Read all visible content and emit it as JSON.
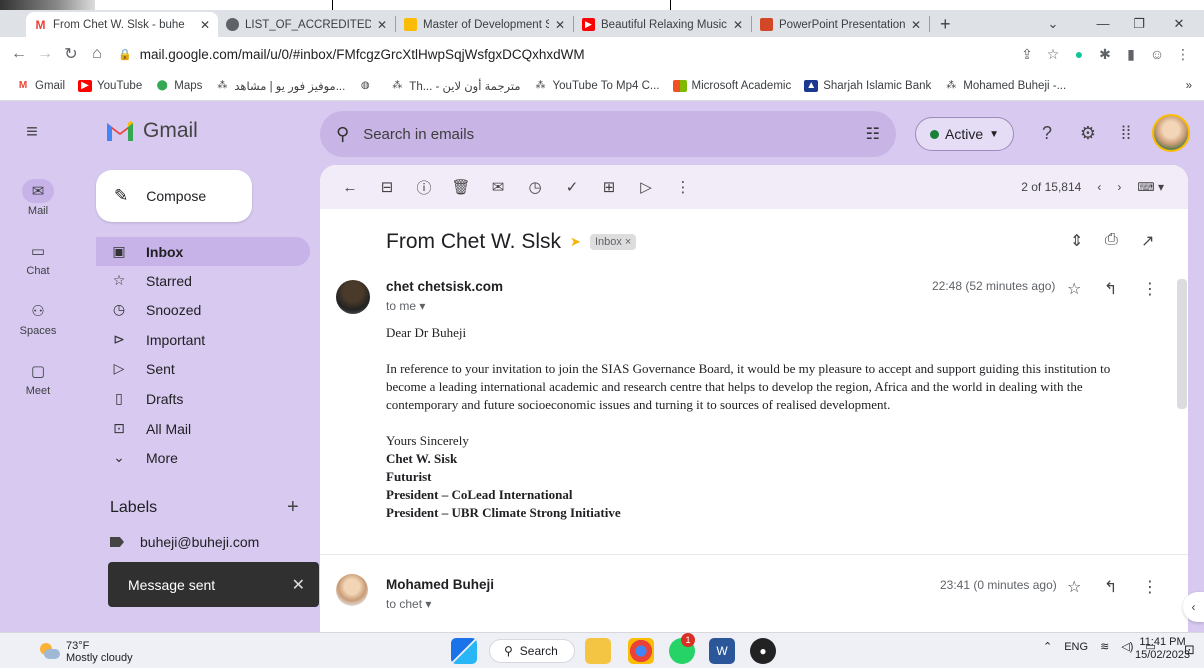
{
  "browser": {
    "tabs": [
      {
        "title": "From Chet W. Slsk - buhe",
        "icon": "gmail-icon",
        "close": "✕"
      },
      {
        "title": "LIST_OF_ACCREDITED_AC",
        "icon": "globe-icon",
        "close": "✕"
      },
      {
        "title": "Master of Development S",
        "icon": "miro-icon",
        "close": "✕"
      },
      {
        "title": "Beautiful Relaxing Music",
        "icon": "youtube-icon",
        "close": "✕"
      },
      {
        "title": "PowerPoint Presentation",
        "icon": "powerpoint-icon",
        "close": "✕"
      }
    ],
    "new_tab": "+",
    "url": "mail.google.com/mail/u/0/#inbox/FMfcgzGrcXtlHwpSqjWsfgxDCQxhxdWM",
    "bookmarks": [
      {
        "label": "Gmail",
        "icon": "gmail-icon"
      },
      {
        "label": "YouTube",
        "icon": "youtube-icon"
      },
      {
        "label": "Maps",
        "icon": "maps-icon"
      },
      {
        "label": "موفيز فور يو | مشاهد...",
        "icon": "bookmark-icon"
      },
      {
        "label": "",
        "icon": "globe-icon"
      },
      {
        "label": "Th... - مترجمة أون لاين",
        "icon": "bookmark-icon"
      },
      {
        "label": "YouTube To Mp4 C...",
        "icon": "bookmark-icon"
      },
      {
        "label": "Microsoft Academic",
        "icon": "microsoft-icon"
      },
      {
        "label": "Sharjah Islamic Bank",
        "icon": "bank-icon"
      },
      {
        "label": "Mohamed Buheji -...",
        "icon": "bookmark-icon"
      }
    ],
    "bookmarks_more": "»"
  },
  "gmail": {
    "logo": "Gmail",
    "search_placeholder": "Search in emails",
    "status": "Active",
    "rail": [
      {
        "label": "Mail",
        "icon": "mail-icon"
      },
      {
        "label": "Chat",
        "icon": "chat-icon"
      },
      {
        "label": "Spaces",
        "icon": "spaces-icon"
      },
      {
        "label": "Meet",
        "icon": "meet-icon"
      }
    ],
    "compose": "Compose",
    "nav": [
      {
        "label": "Inbox",
        "icon": "inbox-icon"
      },
      {
        "label": "Starred",
        "icon": "star-icon"
      },
      {
        "label": "Snoozed",
        "icon": "clock-icon"
      },
      {
        "label": "Important",
        "icon": "important-icon"
      },
      {
        "label": "Sent",
        "icon": "send-icon"
      },
      {
        "label": "Drafts",
        "icon": "draft-icon"
      },
      {
        "label": "All Mail",
        "icon": "all-mail-icon"
      },
      {
        "label": "More",
        "icon": "chevron-down-icon"
      }
    ],
    "labels_title": "Labels",
    "labels_add": "+",
    "labels": [
      "buheji@buheji.com"
    ],
    "toast": {
      "text": "Message sent",
      "close": "✕"
    },
    "pager": {
      "text": "2 of 15,814"
    },
    "thread": {
      "subject": "From Chet W. Slsk",
      "chip": "Inbox ×",
      "messages": [
        {
          "sender": "chet chetsisk.com",
          "to": "to me ▾",
          "time": "22:48 (52 minutes ago)",
          "greeting": "Dear Dr Buheji",
          "paragraph": "In reference to your invitation to join the SIAS Governance Board, it would be my pleasure to accept and support guiding this institution to become a leading international academic and research centre that helps to develop the region, Africa and the world in dealing with the contemporary and future socioeconomic issues and turning it to sources of realised development.",
          "closing": "Yours Sincerely",
          "signature": [
            "Chet W. Sisk",
            "Futurist",
            "President – CoLead International",
            "President – UBR Climate Strong Initiative"
          ]
        },
        {
          "sender": "Mohamed Buheji",
          "to": "to chet ▾",
          "time": "23:41 (0 minutes ago)"
        }
      ]
    }
  },
  "taskbar": {
    "weather_temp": "73°F",
    "weather_desc": "Mostly cloudy",
    "search": "Search",
    "notification_badge": "1",
    "lang": "ENG",
    "time": "11:41 PM",
    "date": "15/02/2023"
  },
  "colors": {
    "gmail_bg": "#d7c9ef",
    "selected": "#c7b3e8",
    "active_dot": "#188038"
  }
}
